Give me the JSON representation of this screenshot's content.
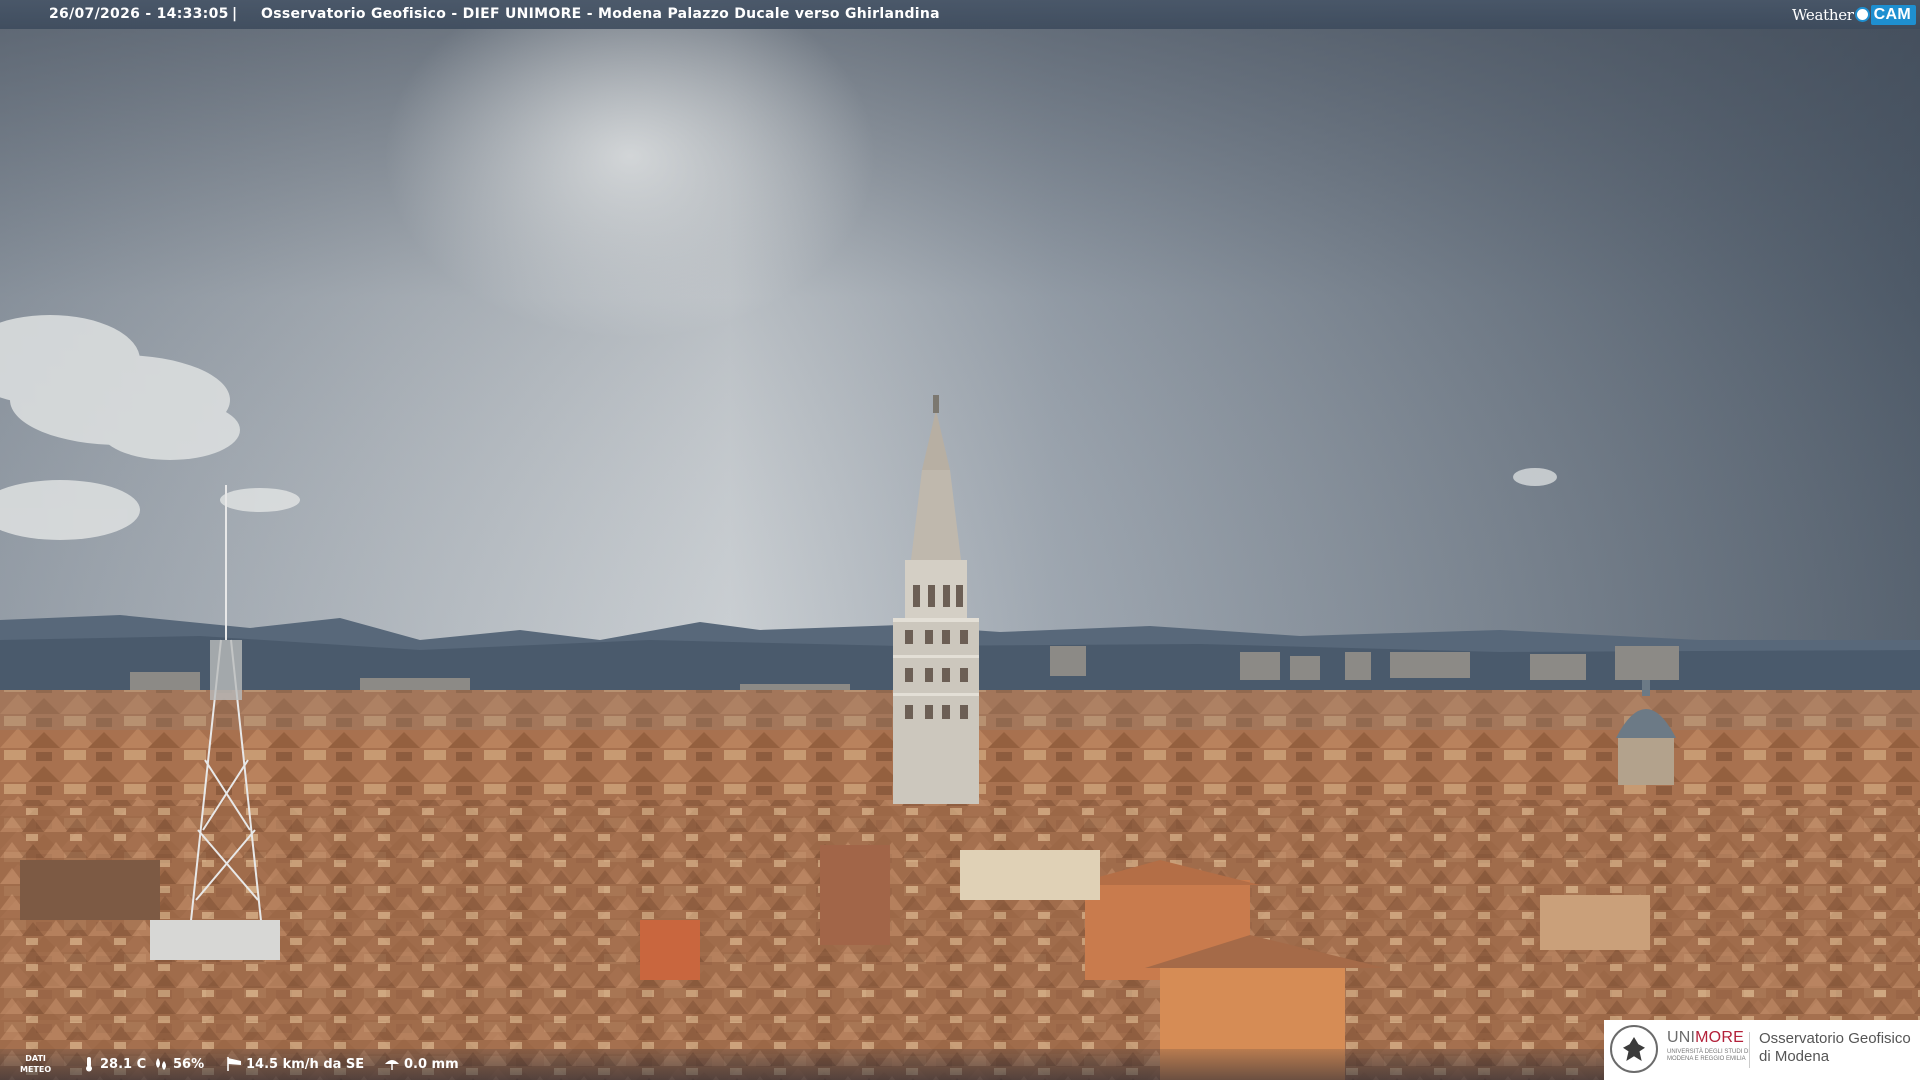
{
  "overlay": {
    "timestamp": "26/07/2026 - 14:33:05",
    "separator": "|",
    "camera_title": "Osservatorio Geofisico - DIEF UNIMORE - Modena Palazzo Ducale verso Ghirlandina",
    "brand_left": "Weather",
    "brand_right": "CAM"
  },
  "weather": {
    "section_label_line1": "DATI",
    "section_label_line2": "METEO",
    "temperature": "28.1 C",
    "humidity": "56%",
    "wind": "14.5 km/h da SE",
    "rain": "0.0 mm",
    "icons": [
      "thermometer-icon",
      "humidity-drops-icon",
      "wind-sock-icon",
      "rain-gauge-icon"
    ]
  },
  "logo": {
    "uni_prefix": "UNI",
    "uni_suffix": "MORE",
    "uni_sub_line1": "UNIVERSITÀ DEGLI STUDI DI",
    "uni_sub_line2": "MODENA E REGGIO EMILIA",
    "observatory_line1": "Osservatorio Geofisico",
    "observatory_line2": "di Modena",
    "brand_color": "#b3213a"
  },
  "colors": {
    "sky_top": "#5a6472",
    "sky_bright": "#c9ced2",
    "sky_storm": "#4e5968",
    "roof": "#b07a56",
    "brand_blue": "#1e8fd0"
  }
}
